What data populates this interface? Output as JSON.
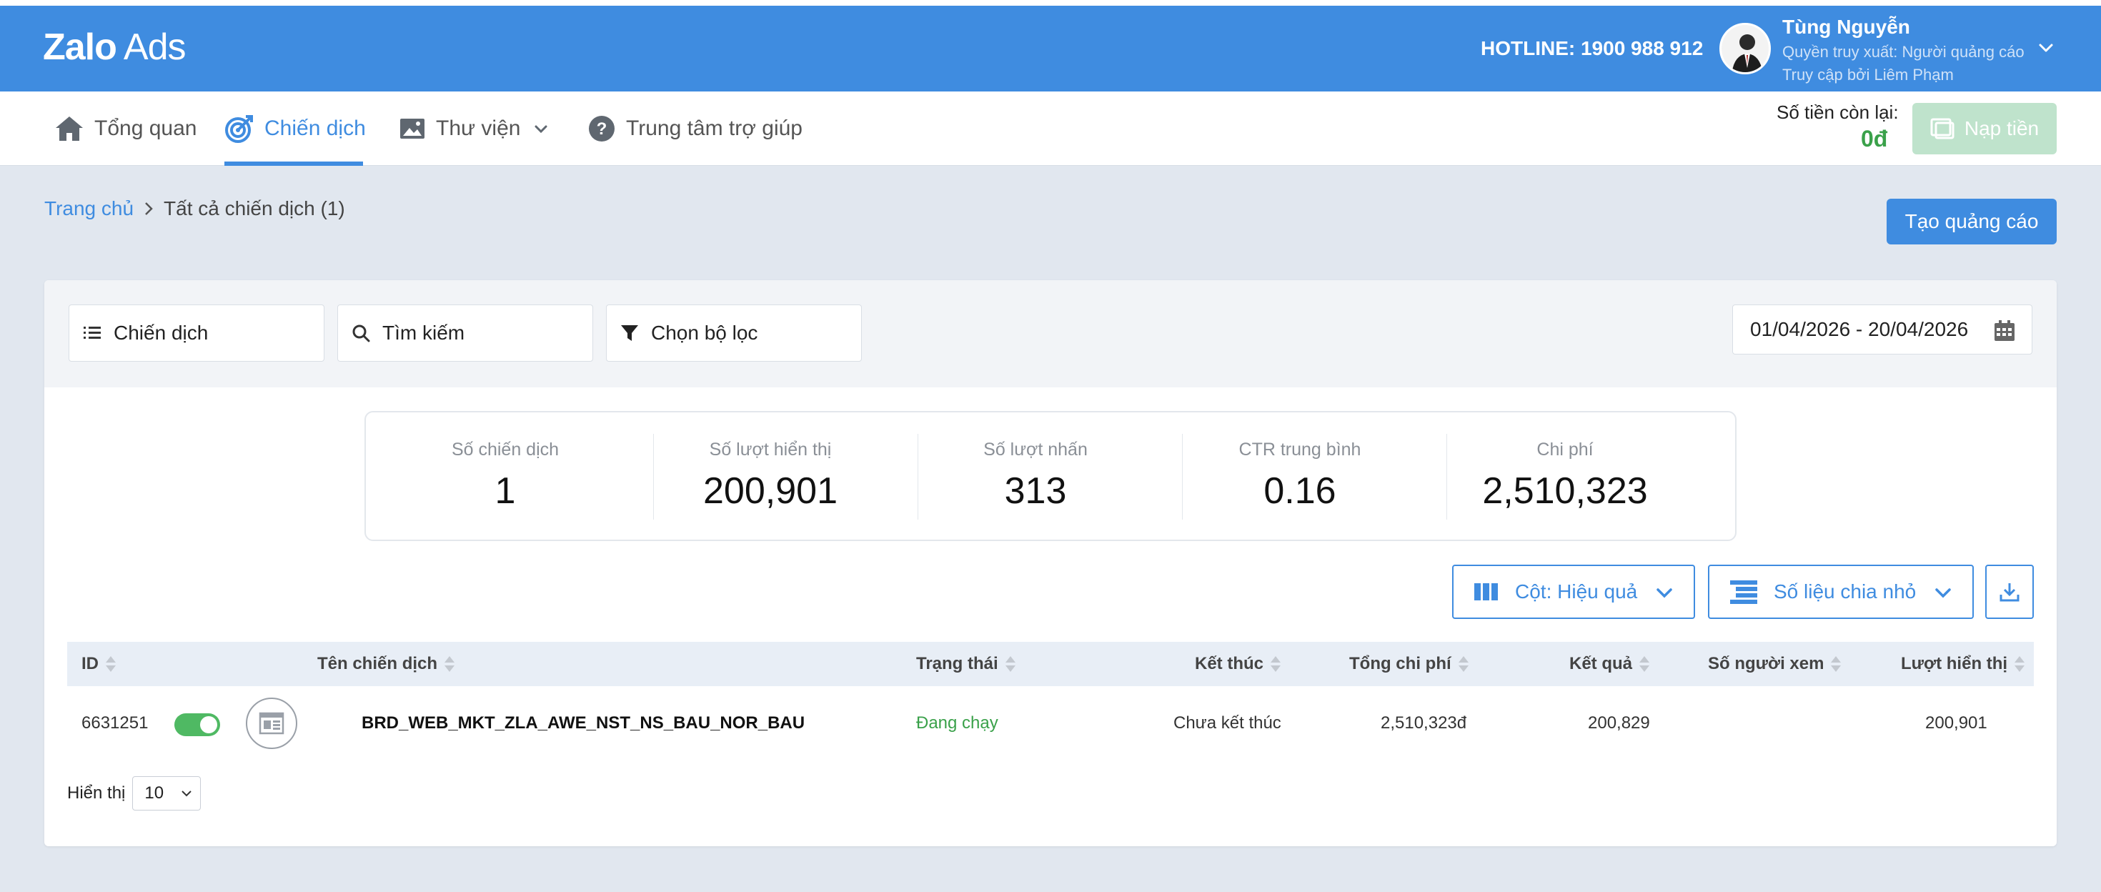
{
  "brand": {
    "name_bold": "Zalo",
    "name_light": "Ads"
  },
  "header": {
    "hotline": "HOTLINE: 1900 988 912",
    "user_name": "Tùng Nguyễn",
    "user_role": "Quyền truy xuất: Người quảng cáo",
    "user_accessed_by": "Truy cập bởi Liêm Phạm"
  },
  "nav": {
    "items": [
      {
        "label": "Tổng quan",
        "icon": "home-icon"
      },
      {
        "label": "Chiến dịch",
        "icon": "target-icon",
        "active": true
      },
      {
        "label": "Thư viện",
        "icon": "image-icon"
      },
      {
        "label": "Trung tâm trợ giúp",
        "icon": "help-icon"
      }
    ],
    "balance_label": "Số tiền còn lại:",
    "balance_value": "0đ",
    "topup_label": "Nạp tiền"
  },
  "breadcrumb": {
    "home": "Trang chủ",
    "current": "Tất cả chiến dịch (1)"
  },
  "create_button": "Tạo quảng cáo",
  "filters": {
    "view_label": "Chiến dịch",
    "search_placeholder": "Tìm kiếm",
    "filter_label": "Chọn bộ lọc",
    "date_range": "01/04/2026 - 20/04/2026"
  },
  "stats": [
    {
      "label": "Số chiến dịch",
      "value": "1"
    },
    {
      "label": "Số lượt hiển thị",
      "value": "200,901"
    },
    {
      "label": "Số lượt nhấn",
      "value": "313"
    },
    {
      "label": "CTR trung bình",
      "value": "0.16"
    },
    {
      "label": "Chi phí",
      "value": "2,510,323"
    }
  ],
  "actions": {
    "columns_label": "Cột: Hiệu quả",
    "breakdown_label": "Số liệu chia nhỏ"
  },
  "table": {
    "headers": [
      "ID",
      "Tên chiến dịch",
      "Trạng thái",
      "Kết thúc",
      "Tổng chi phí",
      "Kết quả",
      "Số người xem",
      "Lượt hiển thị"
    ],
    "rows": [
      {
        "id": "6631251",
        "enabled": true,
        "name": "BRD_WEB_MKT_ZLA_AWE_NST_NS_BAU_NOR_BAU",
        "status": "Đang chạy",
        "end": "Chưa kết thúc",
        "total_cost": "2,510,323đ",
        "result": "200,829",
        "viewers": "",
        "impressions": "200,901"
      }
    ]
  },
  "pager": {
    "label": "Hiển thị",
    "page_size": "10"
  },
  "colors": {
    "primary": "#3f8ce0",
    "success": "#3aa14a",
    "topup_disabled": "#bfe3cc"
  }
}
